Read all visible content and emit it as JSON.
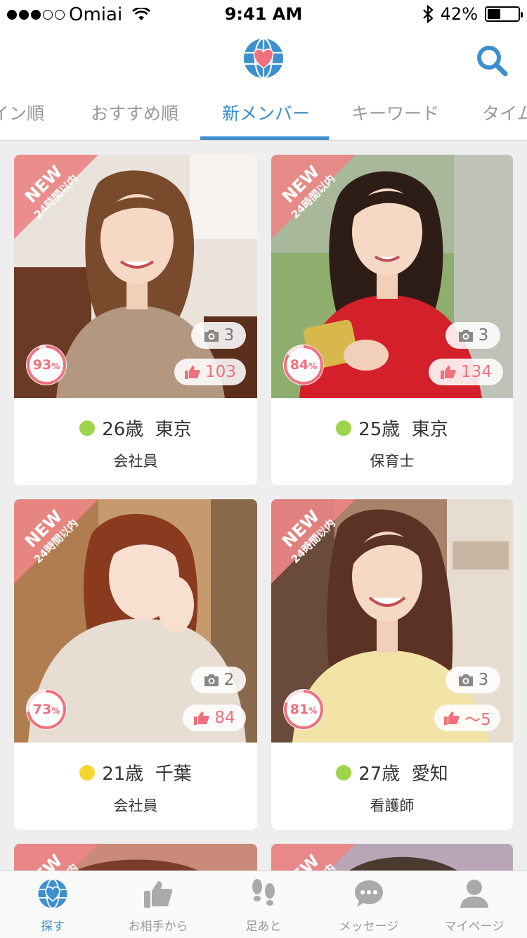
{
  "status_bar": {
    "carrier": "Omiai",
    "time": "9:41 AM",
    "battery": "42%",
    "battery_level": 0.42
  },
  "header": {
    "tabs": [
      {
        "label": "イン順",
        "active": false
      },
      {
        "label": "おすすめ順",
        "active": false
      },
      {
        "label": "新メンバー",
        "active": true
      },
      {
        "label": "キーワード",
        "active": false
      },
      {
        "label": "タイム",
        "active": false
      }
    ]
  },
  "badge": {
    "new": "NEW",
    "sub": "24時間以内"
  },
  "cards": [
    {
      "age_location": "26歳  東京",
      "job": "会社員",
      "photos": "3",
      "likes": "103",
      "match": "93",
      "status_color": "#9ed44a"
    },
    {
      "age_location": "25歳  東京",
      "job": "保育士",
      "photos": "3",
      "likes": "134",
      "match": "84",
      "status_color": "#9ed44a"
    },
    {
      "age_location": "21歳  千葉",
      "job": "会社員",
      "photos": "2",
      "likes": "84",
      "match": "73",
      "status_color": "#f6d531"
    },
    {
      "age_location": "27歳  愛知",
      "job": "看護師",
      "photos": "3",
      "likes": "〜5",
      "match": "81",
      "status_color": "#9ed44a"
    }
  ],
  "bottom_nav": [
    {
      "label": "探す",
      "icon": "globe-heart-icon",
      "active": true
    },
    {
      "label": "お相手から",
      "icon": "thumbs-up-icon",
      "active": false
    },
    {
      "label": "足あと",
      "icon": "footprints-icon",
      "active": false
    },
    {
      "label": "メッセージ",
      "icon": "chat-bubble-icon",
      "active": false
    },
    {
      "label": "マイページ",
      "icon": "person-icon",
      "active": false
    }
  ],
  "colors": {
    "accent": "#3d8fce",
    "like": "#f0707c",
    "banner": "#ec8585"
  }
}
